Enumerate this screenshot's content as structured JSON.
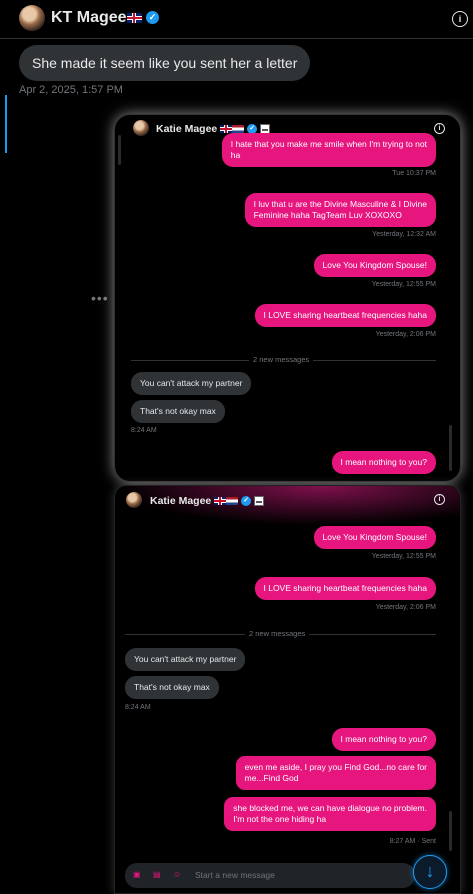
{
  "header": {
    "name": "KT Magee",
    "name_flags": [
      "uk-flag"
    ],
    "verified": true,
    "info_icon": "info-icon"
  },
  "message": {
    "text": "She made it seem like you sent her a letter",
    "timestamp": "Apr 2, 2025, 1:57 PM"
  },
  "more_icon_label": "•••",
  "screenshot1": {
    "contact_name": "Katie Magee",
    "messages": [
      {
        "side": "sent",
        "text_line1": "I hate that you make me smile when I'm trying to not",
        "text_line2": "ha",
        "time": "Tue 10:37 PM"
      },
      {
        "side": "sent",
        "text_line1": "I luv that u are the Divine Masculine & I Divine",
        "text_line2": "Feminine haha TagTeam Luv XOXOXO",
        "time": "Yesterday, 12:32 AM"
      },
      {
        "side": "sent",
        "text": "Love You Kingdom Spouse!",
        "time": "Yesterday, 12:55 PM"
      },
      {
        "side": "sent",
        "text": "I LOVE sharing heartbeat frequencies haha",
        "time": "Yesterday, 2:06 PM"
      },
      {
        "side": "received",
        "text": "You can't attack my partner"
      },
      {
        "side": "received",
        "text": "That's not okay max",
        "time": "8:24 AM"
      },
      {
        "side": "sent",
        "text": "I mean nothing to you?"
      }
    ],
    "divider": "2 new messages"
  },
  "screenshot2": {
    "contact_name": "Katie Magee",
    "messages": [
      {
        "side": "sent",
        "text": "Love You Kingdom Spouse!",
        "time": "Yesterday, 12:55 PM"
      },
      {
        "side": "sent",
        "text": "I LOVE sharing heartbeat frequencies haha",
        "time": "Yesterday, 2:06 PM"
      },
      {
        "side": "received",
        "text": "You can't attack my partner"
      },
      {
        "side": "received",
        "text": "That's not okay max",
        "time": "8:24 AM"
      },
      {
        "side": "sent",
        "text": "I mean nothing to you?"
      },
      {
        "side": "sent",
        "text_line1": "even me aside, I pray you Find God...no care for",
        "text_line2": "me...Find God"
      },
      {
        "side": "sent",
        "text_line1": "she blocked me, we can have dialogue no problem.",
        "text_line2": "I'm not the one hiding ha",
        "time": "8:27 AM · Sent"
      }
    ],
    "divider": "2 new messages",
    "composer_placeholder": "Start a new message"
  },
  "colors": {
    "accent_pink": "#e7167f",
    "bubble_gray": "#2f3336",
    "verified_blue": "#1d9bf0",
    "muted": "#71767b"
  }
}
